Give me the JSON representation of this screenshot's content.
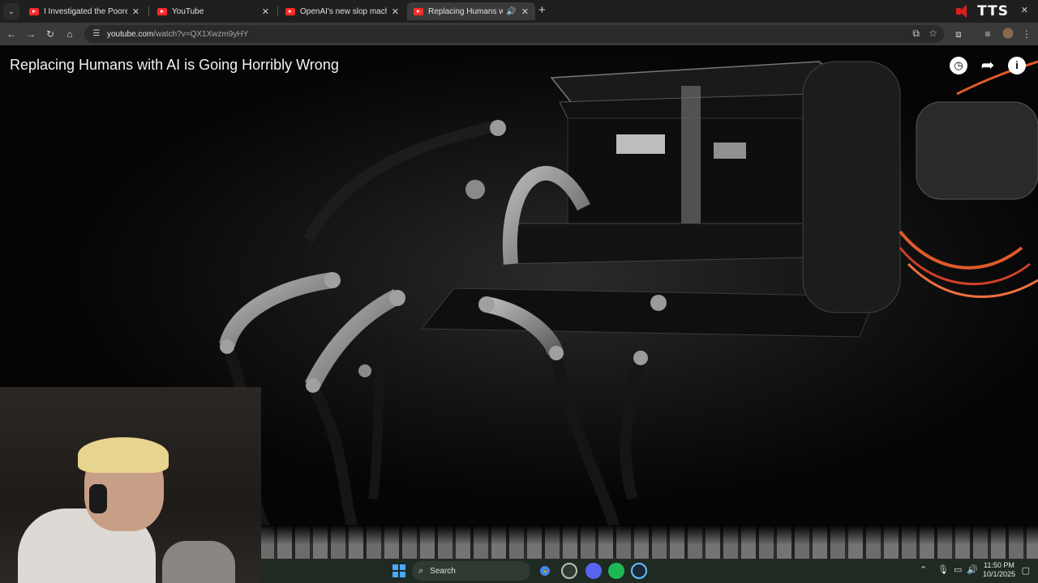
{
  "browser": {
    "tabs": [
      {
        "title": "I Investigated the Poorest Town"
      },
      {
        "title": "YouTube"
      },
      {
        "title": "OpenAI's new slop machine is"
      },
      {
        "title": "Replacing Humans with AI"
      }
    ],
    "new_tab_symbol": "+",
    "tab_close_symbol": "✕",
    "url_domain": "youtube.com",
    "url_path": "/watch?v=QX1Xwzm9yHY"
  },
  "overlay": {
    "tts_label": "TTS"
  },
  "video": {
    "title": "Replacing Humans with AI is Going Horribly Wrong",
    "icons": [
      "clock-icon",
      "share-icon",
      "info-icon"
    ]
  },
  "taskbar": {
    "search_placeholder": "Search",
    "time": "11:50 PM",
    "date": "10/1/2025"
  },
  "colors": {
    "youtube_red": "#ff2a2a",
    "taskbar_bg": "#1f2a23",
    "chrome_bg": "#1f1f1f"
  }
}
